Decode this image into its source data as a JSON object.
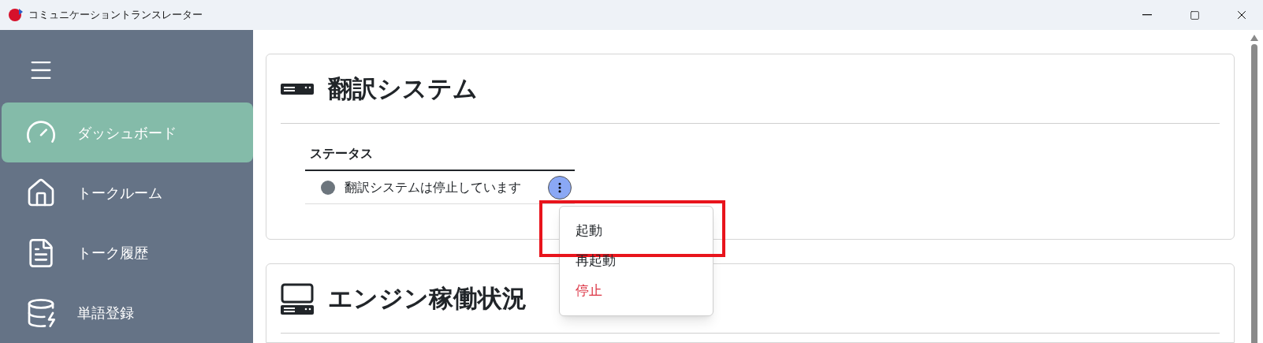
{
  "window": {
    "title": "コミュニケーショントランスレーター"
  },
  "sidebar": {
    "items": [
      {
        "label": "ダッシュボード",
        "selected": true
      },
      {
        "label": "トークルーム",
        "selected": false
      },
      {
        "label": "トーク履歴",
        "selected": false
      },
      {
        "label": "単語登録",
        "selected": false
      }
    ]
  },
  "cards": [
    {
      "title": "翻訳システム",
      "status": {
        "heading": "ステータス",
        "text": "翻訳システムは停止しています",
        "color": "#6c757d"
      }
    },
    {
      "title": "エンジン稼働状況"
    }
  ],
  "menu": {
    "items": [
      {
        "label": "起動",
        "kind": "normal",
        "highlighted": true
      },
      {
        "label": "再起動",
        "kind": "normal",
        "highlighted": false
      },
      {
        "label": "停止",
        "kind": "danger",
        "highlighted": false
      }
    ]
  }
}
